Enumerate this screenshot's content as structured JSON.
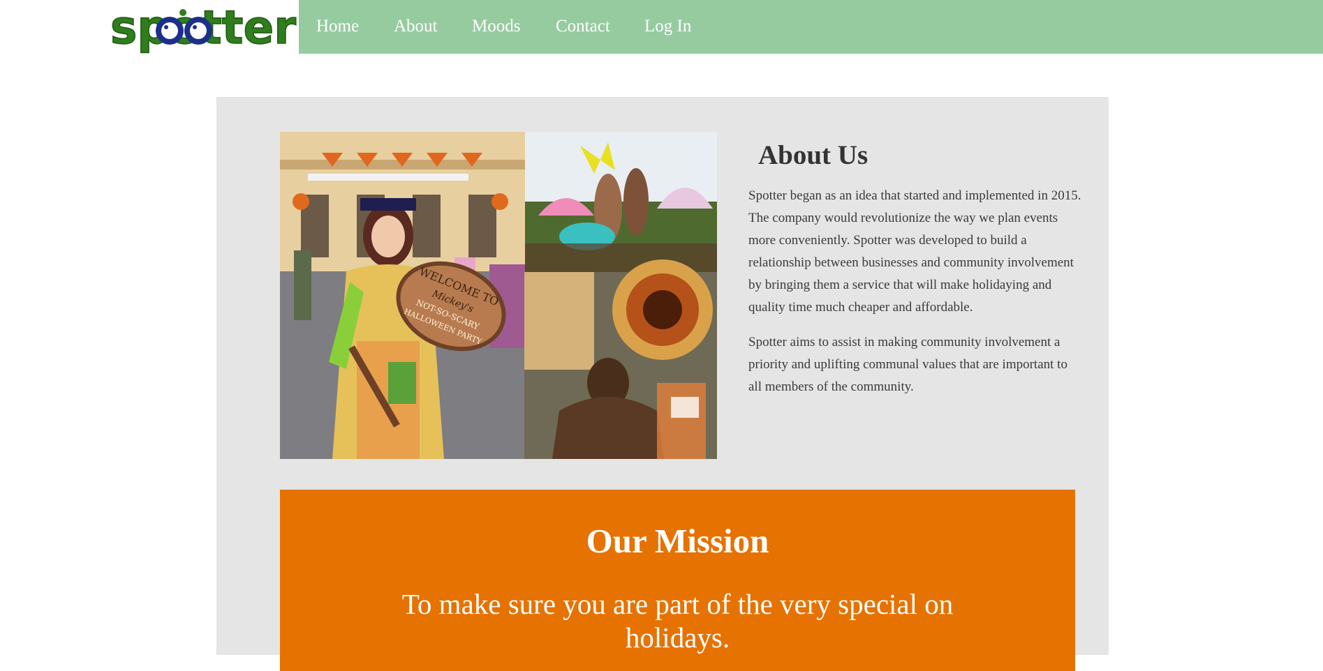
{
  "header": {
    "logo_text": "spotter",
    "nav": [
      {
        "label": "Home"
      },
      {
        "label": "About"
      },
      {
        "label": "Moods"
      },
      {
        "label": "Contact"
      },
      {
        "label": "Log In"
      }
    ]
  },
  "colors": {
    "nav_background": "#96cba0",
    "panel_background": "#e5e5e5",
    "mission_background": "#e67202",
    "logo_green": "#2f7d1c",
    "logo_blue": "#1d2f8c"
  },
  "about": {
    "title": "About Us",
    "paragraphs": [
      "Spotter began as an idea that started and implemented in 2015. The company would revolutionize the way we plan events more conveniently. Spotter was developed to build a relationship between businesses and community involvement by bringing them a service that will make holidaying and quality time much cheaper and affordable.",
      "Spotter aims to assist in making community involvement a priority and uplifting communal values that are important to all members of the community."
    ]
  },
  "collage": {
    "sign_text": [
      "WELCOME TO",
      "Mickey's",
      "NOT-SO-SCARY",
      "HALLOWEEN PARTY"
    ]
  },
  "mission": {
    "title": "Our Mission",
    "text": "To make sure you are part of the very special on holidays."
  }
}
